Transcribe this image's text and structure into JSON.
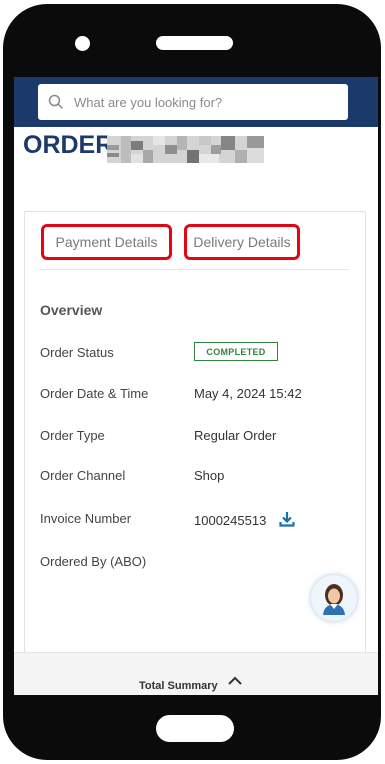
{
  "search": {
    "placeholder": "What are you looking for?"
  },
  "order": {
    "title_prefix": "ORDER"
  },
  "tabs": [
    {
      "label": "Payment Details"
    },
    {
      "label": "Delivery Details"
    }
  ],
  "overview": {
    "heading": "Overview",
    "rows": [
      {
        "label": "Order Status",
        "value": "COMPLETED"
      },
      {
        "label": "Order Date & Time",
        "value": "May 4, 2024 15:42"
      },
      {
        "label": "Order Type",
        "value": "Regular Order"
      },
      {
        "label": "Order Channel",
        "value": "Shop"
      },
      {
        "label": "Invoice Number",
        "value": "1000245513"
      },
      {
        "label": "Ordered By (ABO)",
        "value": ""
      }
    ]
  },
  "footer": {
    "summary_label": "Total Summary"
  },
  "icons": {
    "search": "search-icon",
    "download": "download-icon",
    "chevron": "chevron-up-icon",
    "assistant": "assistant-avatar"
  },
  "colors": {
    "brand_navy": "#1b3a6b",
    "highlight_red": "#e30613",
    "status_green": "#2e8540",
    "download_blue": "#1a6fb0"
  }
}
